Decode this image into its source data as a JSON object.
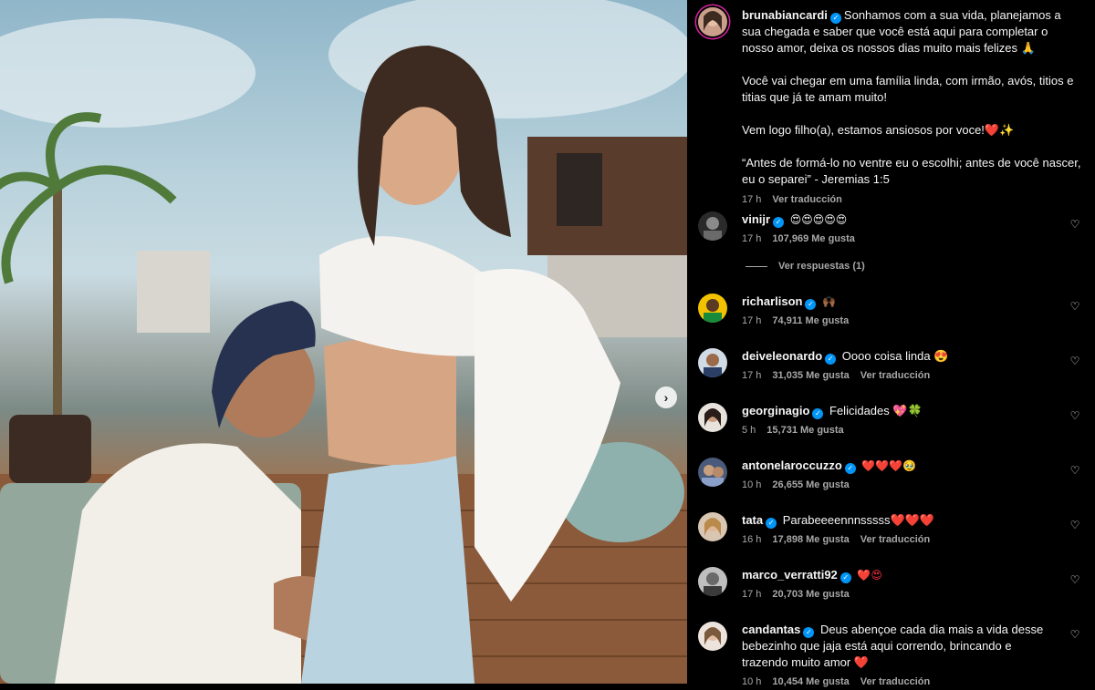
{
  "post": {
    "username": "brunabiancardi",
    "caption_lines": [
      "Sonhamos com a sua vida, planejamos a sua chegada e saber que você está aqui para completar o nosso amor, deixa os nossos dias muito mais felizes 🙏",
      "Você vai chegar em uma família linda, com irmão, avós, titios e titias que já te amam muito!",
      "Vem logo filho(a), estamos ansiosos por voce!❤️✨",
      "“Antes de formá-lo no ventre eu o escolhi; antes de você nascer, eu o separei” - Jeremias 1:5"
    ],
    "time": "17 h",
    "translate": "Ver traducción"
  },
  "comments": [
    {
      "username": "vinijr",
      "text": "😍😍😍😍😍",
      "time": "17 h",
      "likes": "107,969 Me gusta",
      "translate": ""
    },
    {
      "username": "richarlison",
      "text": "🙌🏾",
      "time": "17 h",
      "likes": "74,911 Me gusta",
      "translate": ""
    },
    {
      "username": "deiveleonardo",
      "text": "Oooo coisa linda 😍",
      "time": "17 h",
      "likes": "31,035 Me gusta",
      "translate": "Ver traducción"
    },
    {
      "username": "georginagio",
      "text": "Felicidades 💖🍀",
      "time": "5 h",
      "likes": "15,731 Me gusta",
      "translate": ""
    },
    {
      "username": "antonelaroccuzzo",
      "text": "❤️❤️❤️🥹",
      "time": "10 h",
      "likes": "26,655 Me gusta",
      "translate": ""
    },
    {
      "username": "tata",
      "text": "Parabeeeennnsssss❤️❤️❤️",
      "time": "16 h",
      "likes": "17,898 Me gusta",
      "translate": "Ver traducción"
    },
    {
      "username": "marco_verratti92",
      "text": "❤️😍",
      "time": "17 h",
      "likes": "20,703 Me gusta",
      "translate": ""
    },
    {
      "username": "candantas",
      "text": "Deus abençoe cada dia mais a vida desse bebezinho que jaja está aqui correndo, brincando e trazendo muito amor ❤️",
      "time": "10 h",
      "likes": "10,454 Me gusta",
      "translate": "Ver traducción"
    }
  ],
  "replies_label": "Ver respuestas (1)",
  "icons": {
    "verified": "verified-badge-icon",
    "like": "heart-icon",
    "carousel": "chevron-right-icon"
  },
  "colors": {
    "background": "#000000",
    "text": "#f5f5f5",
    "muted": "#a8a8a8",
    "verified": "#0095f6"
  }
}
